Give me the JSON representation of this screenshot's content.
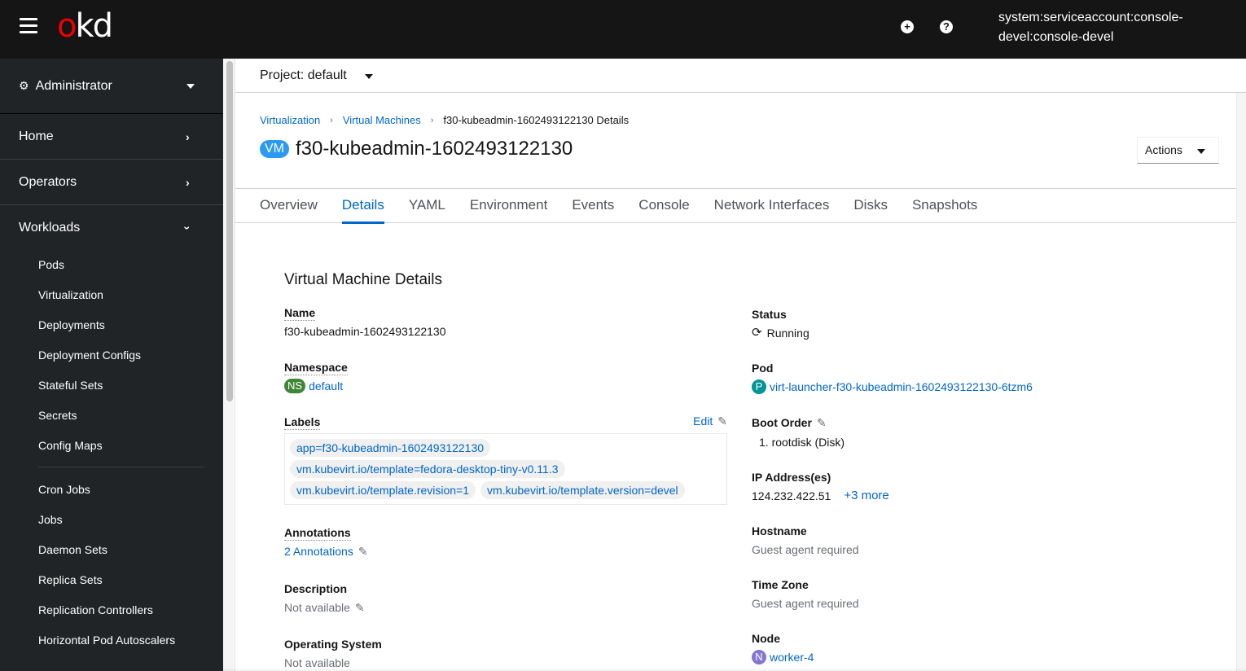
{
  "masthead": {
    "logo_o": "o",
    "logo_kd": "kd",
    "add_icon": "plus-circle-icon",
    "help_icon": "question-circle-icon",
    "user": "system:serviceaccount:console-devel:console-devel"
  },
  "sidebar": {
    "perspective": "Administrator",
    "sections": [
      {
        "label": "Home",
        "state": "collapsed"
      },
      {
        "label": "Operators",
        "state": "collapsed"
      },
      {
        "label": "Workloads",
        "state": "expanded"
      }
    ],
    "workloads_items": [
      "Pods",
      "Virtualization",
      "Deployments",
      "Deployment Configs",
      "Stateful Sets",
      "Secrets",
      "Config Maps"
    ],
    "workloads_items_2": [
      "Cron Jobs",
      "Jobs",
      "Daemon Sets",
      "Replica Sets",
      "Replication Controllers",
      "Horizontal Pod Autoscalers"
    ]
  },
  "project": {
    "label": "Project: default"
  },
  "breadcrumb": [
    {
      "label": "Virtualization",
      "link": true
    },
    {
      "label": "Virtual Machines",
      "link": true
    },
    {
      "label": "f30-kubeadmin-1602493122130 Details",
      "link": false
    }
  ],
  "header": {
    "badge": "VM",
    "title": "f30-kubeadmin-1602493122130",
    "actions_label": "Actions"
  },
  "tabs": [
    {
      "label": "Overview",
      "active": false
    },
    {
      "label": "Details",
      "active": true
    },
    {
      "label": "YAML",
      "active": false
    },
    {
      "label": "Environment",
      "active": false
    },
    {
      "label": "Events",
      "active": false
    },
    {
      "label": "Console",
      "active": false
    },
    {
      "label": "Network Interfaces",
      "active": false
    },
    {
      "label": "Disks",
      "active": false
    },
    {
      "label": "Snapshots",
      "active": false
    }
  ],
  "details": {
    "section_title": "Virtual Machine Details",
    "name": {
      "label": "Name",
      "value": "f30-kubeadmin-1602493122130"
    },
    "namespace": {
      "label": "Namespace",
      "badge": "NS",
      "badge_color": "#3e8635",
      "value": "default"
    },
    "labels": {
      "label": "Labels",
      "edit": "Edit",
      "items": [
        "app=f30-kubeadmin-1602493122130",
        "vm.kubevirt.io/template=fedora-desktop-tiny-v0.11.3",
        "vm.kubevirt.io/template.revision=1",
        "vm.kubevirt.io/template.version=devel"
      ]
    },
    "annotations": {
      "label": "Annotations",
      "value": "2 Annotations"
    },
    "description": {
      "label": "Description",
      "value": "Not available"
    },
    "os": {
      "label": "Operating System",
      "value": "Not available"
    },
    "status": {
      "label": "Status",
      "value": "Running"
    },
    "pod": {
      "label": "Pod",
      "badge": "P",
      "badge_color": "#009596",
      "value": "virt-launcher-f30-kubeadmin-1602493122130-6tzm6"
    },
    "boot_order": {
      "label": "Boot Order",
      "items": [
        "1. rootdisk (Disk)"
      ]
    },
    "ip": {
      "label": "IP Address(es)",
      "value": "124.232.422.51",
      "more": "+3 more"
    },
    "hostname": {
      "label": "Hostname",
      "value": "Guest agent required"
    },
    "timezone": {
      "label": "Time Zone",
      "value": "Guest agent required"
    },
    "node": {
      "label": "Node",
      "badge": "N",
      "badge_color": "#8476d1",
      "value": "worker-4"
    }
  },
  "colors": {
    "link": "#0066cc",
    "masthead_bg": "#151515",
    "sidebar_bg": "#212427",
    "vm_badge": "#2b9af3",
    "logo_accent": "#ee0000"
  }
}
